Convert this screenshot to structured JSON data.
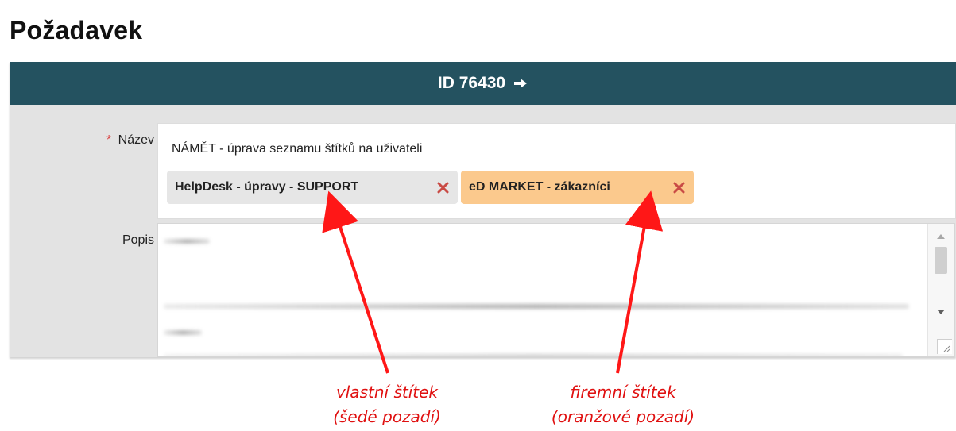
{
  "page": {
    "title": "Požadavek"
  },
  "panel": {
    "header_label": "ID  76430",
    "icons": {
      "header_arrow": "arrow-right-icon",
      "tag_remove": "close-icon",
      "scroll_up": "chevron-up-icon",
      "scroll_down": "chevron-down-icon",
      "resize": "resize-handle-icon"
    }
  },
  "form": {
    "name_label_required_mark": "*",
    "name_label": "Název",
    "name_value": "NÁMĚT - úprava seznamu štítků na uživateli",
    "description_label": "Popis",
    "tags": [
      {
        "label": "HelpDesk - úpravy - SUPPORT",
        "background": "#e6e6e6"
      },
      {
        "label": "eD MARKET - zákazníci",
        "background": "#fbc98d"
      }
    ]
  },
  "annotations": [
    {
      "line1": "vlastní štítek",
      "line2": "(šedé pozadí)"
    },
    {
      "line1": "firemní štítek",
      "line2": "(oranžové pozadí)"
    }
  ],
  "colors": {
    "header_background": "#245260",
    "panel_background": "#e3e3e3",
    "required_mark": "#d93535",
    "remove_icon": "#c94b45",
    "annotation": "#e01010"
  }
}
